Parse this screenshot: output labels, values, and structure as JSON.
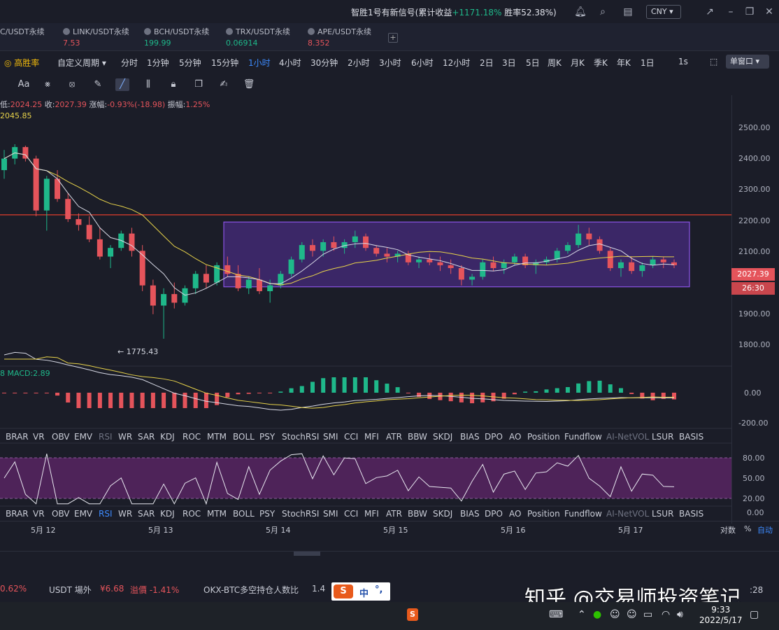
{
  "topbar": {
    "signal_prefix": "智胜1号有新信号(累计收益",
    "signal_gain": "+1171.18%",
    "signal_winrate": "胜率52.38%)",
    "currency": "CNY"
  },
  "symbols": [
    {
      "name": "C/USDT永续",
      "price": ""
    },
    {
      "name": "LINK/USDT永续",
      "price": "7.53",
      "trend": "red"
    },
    {
      "name": "BCH/USDT永续",
      "price": "199.99",
      "trend": "green"
    },
    {
      "name": "TRX/USDT永续",
      "price": "0.06914",
      "trend": "green"
    },
    {
      "name": "APE/USDT永续",
      "price": "8.352",
      "trend": "red"
    }
  ],
  "periods": {
    "win_rate": "高胜率",
    "custom": "自定义周期",
    "items": [
      "分时",
      "1分钟",
      "5分钟",
      "15分钟",
      "1小时",
      "4小时",
      "30分钟",
      "2小时",
      "3小时",
      "6小时",
      "12小时",
      "2日",
      "3日",
      "5日",
      "周K",
      "月K",
      "季K",
      "年K",
      "1日"
    ],
    "active": "1小时",
    "interval_1s": "1s",
    "window": "单窗口"
  },
  "toolbar": {
    "text_tool": "Aa"
  },
  "ohlc": {
    "low_label": "低:",
    "low": "2024.25",
    "close_label": "收:",
    "close": "2027.39",
    "change_label": "涨幅:",
    "change": "-0.93%(-18.98)",
    "amp_label": "振幅:",
    "amp": "1.25%",
    "ma_value": "2045.85"
  },
  "yaxis": {
    "labels": [
      "2500.00",
      "2400.00",
      "2300.00",
      "2200.00",
      "2100.00",
      "1900.00",
      "1800.00"
    ],
    "current_price": "2027.39",
    "countdown": "26:30",
    "macd_labels": [
      "0.00",
      "-200.00"
    ],
    "rsi_labels": [
      "80.00",
      "50.00",
      "20.00",
      "0.00"
    ]
  },
  "low_marker": "← 1775.43",
  "macd": {
    "label": "MACD:2.89",
    "prefix": "8"
  },
  "indicators": [
    "BRAR",
    "VR",
    "OBV",
    "EMV",
    "RSI",
    "WR",
    "SAR",
    "KDJ",
    "ROC",
    "MTM",
    "BOLL",
    "PSY",
    "StochRSI",
    "SMI",
    "CCI",
    "MFI",
    "ATR",
    "BBW",
    "SKDJ",
    "BIAS",
    "DPO",
    "AO",
    "Position",
    "Fundflow",
    "AI-NetVOL",
    "LSUR",
    "BASIS"
  ],
  "dates": [
    "5月 12",
    "5月 13",
    "5月 14",
    "5月 15",
    "5月 16",
    "5月 17"
  ],
  "scale": {
    "log": "对数",
    "pct": "%",
    "auto": "自动"
  },
  "tickers": {
    "pct": "0.62%",
    "usdt_otc": "USDT 場外",
    "usdt_price": "¥6.68",
    "premium": "溢價 -1.41%",
    "ratio_label": "OKX-BTC多空持仓人数比",
    "ratio_value": "1.4"
  },
  "ime": {
    "logo": "S",
    "mode": "中",
    "punct": "°,"
  },
  "watermark": {
    "text": "知乎 @交易师投资笔记",
    "time": ":28"
  },
  "taskbar": {
    "time": "9:33",
    "date": "2022/5/17"
  },
  "chart_data": {
    "type": "candlestick",
    "categories": [
      "5月 12",
      "5月 13",
      "5月 14",
      "5月 15",
      "5月 16",
      "5月 17"
    ],
    "ylim": [
      1750,
      2550
    ],
    "resistance": 2205,
    "box": {
      "low": 1955,
      "high": 2180
    },
    "low_point": 1775.43,
    "last_close": 2027.39,
    "candles": [
      [
        2360,
        2430,
        2330,
        2400
      ],
      [
        2400,
        2450,
        2380,
        2440
      ],
      [
        2440,
        2445,
        2390,
        2400
      ],
      [
        2400,
        2410,
        2200,
        2220
      ],
      [
        2220,
        2340,
        2150,
        2330
      ],
      [
        2330,
        2360,
        2250,
        2260
      ],
      [
        2260,
        2280,
        2180,
        2190
      ],
      [
        2190,
        2210,
        2150,
        2170
      ],
      [
        2170,
        2200,
        2110,
        2120
      ],
      [
        2120,
        2160,
        2050,
        2060
      ],
      [
        2060,
        2100,
        2020,
        2090
      ],
      [
        2090,
        2150,
        2080,
        2140
      ],
      [
        2140,
        2160,
        2060,
        2080
      ],
      [
        2080,
        2100,
        1940,
        1960
      ],
      [
        1960,
        1980,
        1860,
        1890
      ],
      [
        1890,
        1950,
        1775,
        1930
      ],
      [
        1930,
        1970,
        1880,
        1900
      ],
      [
        1900,
        1960,
        1890,
        1950
      ],
      [
        1950,
        2010,
        1930,
        2000
      ],
      [
        2000,
        2030,
        1950,
        1970
      ],
      [
        1970,
        2040,
        1960,
        2030
      ],
      [
        2030,
        2060,
        1990,
        2000
      ],
      [
        2000,
        2030,
        1940,
        1950
      ],
      [
        1950,
        1990,
        1930,
        1980
      ],
      [
        1980,
        2020,
        1930,
        1940
      ],
      [
        1940,
        1980,
        1900,
        1960
      ],
      [
        1960,
        2010,
        1950,
        2000
      ],
      [
        2000,
        2060,
        1990,
        2050
      ],
      [
        2050,
        2110,
        2040,
        2100
      ],
      [
        2100,
        2120,
        2060,
        2080
      ],
      [
        2080,
        2120,
        2060,
        2110
      ],
      [
        2110,
        2130,
        2080,
        2090
      ],
      [
        2090,
        2120,
        2070,
        2110
      ],
      [
        2110,
        2150,
        2090,
        2130
      ],
      [
        2130,
        2140,
        2080,
        2090
      ],
      [
        2090,
        2100,
        2060,
        2070
      ],
      [
        2070,
        2090,
        2040,
        2060
      ],
      [
        2060,
        2080,
        2040,
        2070
      ],
      [
        2070,
        2080,
        2030,
        2040
      ],
      [
        2040,
        2060,
        2020,
        2050
      ],
      [
        2050,
        2070,
        2030,
        2040
      ],
      [
        2040,
        2060,
        2010,
        2030
      ],
      [
        2030,
        2050,
        2000,
        2020
      ],
      [
        2020,
        2030,
        1960,
        1980
      ],
      [
        1980,
        2000,
        1960,
        1990
      ],
      [
        1990,
        2050,
        1980,
        2040
      ],
      [
        2040,
        2060,
        2010,
        2020
      ],
      [
        2020,
        2050,
        2000,
        2040
      ],
      [
        2040,
        2070,
        2030,
        2060
      ],
      [
        2060,
        2070,
        2020,
        2030
      ],
      [
        2030,
        2050,
        2000,
        2040
      ],
      [
        2040,
        2060,
        2030,
        2050
      ],
      [
        2050,
        2090,
        2040,
        2080
      ],
      [
        2080,
        2110,
        2070,
        2100
      ],
      [
        2100,
        2170,
        2090,
        2140
      ],
      [
        2140,
        2160,
        2100,
        2120
      ],
      [
        2120,
        2130,
        2070,
        2080
      ],
      [
        2080,
        2090,
        2010,
        2020
      ],
      [
        2020,
        2050,
        1990,
        2040
      ],
      [
        2040,
        2060,
        2000,
        2010
      ],
      [
        2010,
        2040,
        1990,
        2030
      ],
      [
        2030,
        2060,
        2020,
        2050
      ],
      [
        2050,
        2060,
        2020,
        2040
      ],
      [
        2040,
        2050,
        2020,
        2030
      ]
    ]
  }
}
